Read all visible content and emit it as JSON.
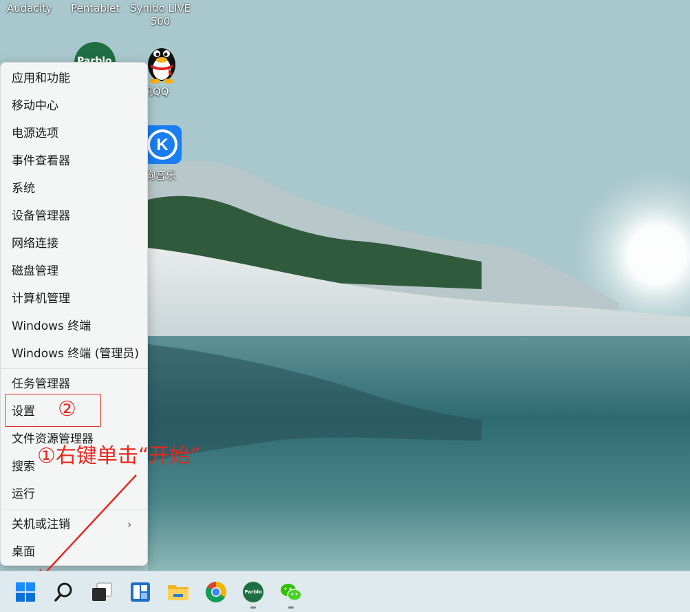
{
  "desktop": {
    "top_labels": [
      "Audacity",
      "Pentablet",
      "Synido LIVE 500"
    ],
    "icons": [
      {
        "label": "Parblo",
        "icon": "parblo-logo-icon"
      },
      {
        "label": "腾讯QQ",
        "icon": "qq-penguin-icon"
      },
      {
        "label": "酷狗音乐",
        "icon": "kugou-music-icon"
      }
    ]
  },
  "context_menu": {
    "items": [
      "应用和功能",
      "移动中心",
      "电源选项",
      "事件查看器",
      "系统",
      "设备管理器",
      "网络连接",
      "磁盘管理",
      "计算机管理",
      "Windows 终端",
      "Windows 终端 (管理员)",
      "任务管理器",
      "设置",
      "文件资源管理器",
      "搜索",
      "运行",
      "关机或注销",
      "桌面"
    ],
    "submenu_chevron": "›"
  },
  "annotations": {
    "step1": "①右键单击“开始”",
    "step2": "②",
    "color": "#e8271f"
  },
  "taskbar": {
    "items": [
      {
        "name": "start-button",
        "icon": "windows-logo-icon"
      },
      {
        "name": "search-button",
        "icon": "search-icon"
      },
      {
        "name": "task-view-button",
        "icon": "task-view-icon"
      },
      {
        "name": "widgets-button",
        "icon": "widgets-icon"
      },
      {
        "name": "file-explorer-button",
        "icon": "folder-icon"
      },
      {
        "name": "chrome-button",
        "icon": "chrome-icon"
      },
      {
        "name": "parblo-button",
        "icon": "parblo-logo-icon",
        "label": "Parblo"
      },
      {
        "name": "wechat-button",
        "icon": "wechat-icon"
      }
    ],
    "accent": "#0078d4"
  }
}
